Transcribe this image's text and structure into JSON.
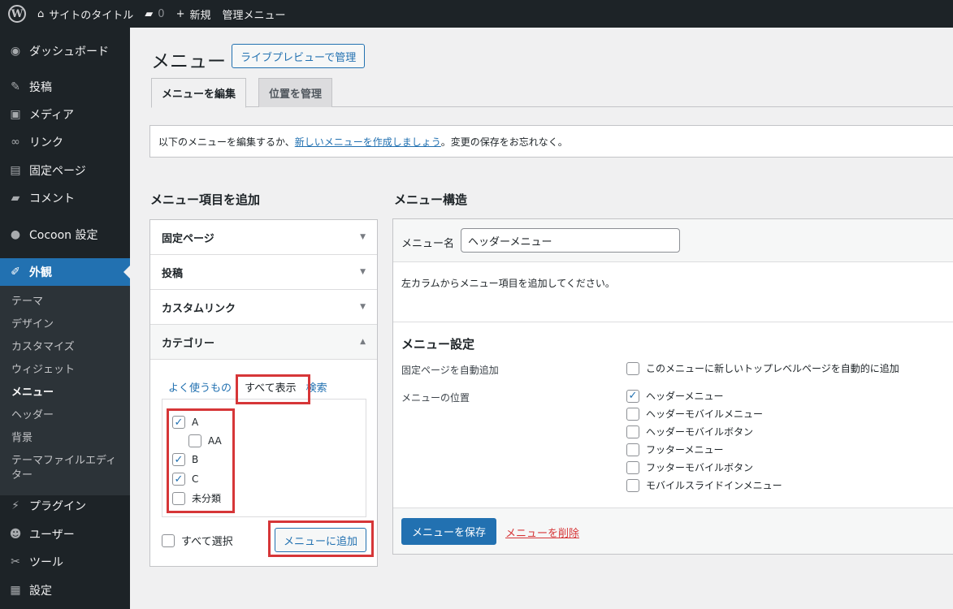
{
  "adminbar": {
    "site_title": "サイトのタイトル",
    "comments_count": "0",
    "new_label": "新規",
    "admin_menu_label": "管理メニュー"
  },
  "sidebar": {
    "items": [
      {
        "label": "ダッシュボード",
        "icon": "dashboard-icon"
      },
      {
        "label": "投稿",
        "icon": "pin-icon"
      },
      {
        "label": "メディア",
        "icon": "media-icon"
      },
      {
        "label": "リンク",
        "icon": "link-icon"
      },
      {
        "label": "固定ページ",
        "icon": "page-icon"
      },
      {
        "label": "コメント",
        "icon": "comment-icon"
      },
      {
        "label": "Cocoon 設定",
        "icon": "circle-icon"
      },
      {
        "label": "外観",
        "icon": "brush-icon"
      },
      {
        "label": "プラグイン",
        "icon": "plugin-icon"
      },
      {
        "label": "ユーザー",
        "icon": "user-icon"
      },
      {
        "label": "ツール",
        "icon": "wrench-icon"
      },
      {
        "label": "設定",
        "icon": "settings-icon"
      }
    ],
    "submenu": [
      "テーマ",
      "デザイン",
      "カスタマイズ",
      "ウィジェット",
      "メニュー",
      "ヘッダー",
      "背景",
      "テーマファイルエディター"
    ]
  },
  "main": {
    "title": "メニュー",
    "live_preview_label": "ライブプレビューで管理",
    "tabs": [
      "メニューを編集",
      "位置を管理"
    ],
    "notice": {
      "prefix": "以下のメニューを編集するか、",
      "link": "新しいメニューを作成しましょう",
      "suffix": "。変更の保存をお忘れなく。"
    }
  },
  "add_items": {
    "heading": "メニュー項目を追加",
    "panels": [
      "固定ページ",
      "投稿",
      "カスタムリンク",
      "カテゴリー"
    ],
    "subtabs": [
      "よく使うもの",
      "すべて表示",
      "検索"
    ],
    "categories": [
      {
        "label": "A",
        "checked": true
      },
      {
        "label": "AA",
        "checked": false
      },
      {
        "label": "B",
        "checked": true
      },
      {
        "label": "C",
        "checked": true
      },
      {
        "label": "未分類",
        "checked": false
      }
    ],
    "select_all_label": "すべて選択",
    "add_button_label": "メニューに追加"
  },
  "structure": {
    "heading": "メニュー構造",
    "menu_name_label": "メニュー名",
    "menu_name_value": "ヘッダーメニュー",
    "instructions": "左カラムからメニュー項目を追加してください。",
    "settings_title": "メニュー設定",
    "auto_add_label": "固定ページを自動追加",
    "auto_add_option": {
      "label": "このメニューに新しいトップレベルページを自動的に追加",
      "checked": false
    },
    "location_label": "メニューの位置",
    "locations": [
      {
        "label": "ヘッダーメニュー",
        "checked": true
      },
      {
        "label": "ヘッダーモバイルメニュー",
        "checked": false
      },
      {
        "label": "ヘッダーモバイルボタン",
        "checked": false
      },
      {
        "label": "フッターメニュー",
        "checked": false
      },
      {
        "label": "フッターモバイルボタン",
        "checked": false
      },
      {
        "label": "モバイルスライドインメニュー",
        "checked": false
      }
    ],
    "save_label": "メニューを保存",
    "delete_label": "メニューを削除"
  },
  "colors": {
    "accent": "#2271b1",
    "highlight": "#d63638",
    "adminbar": "#1d2327"
  }
}
